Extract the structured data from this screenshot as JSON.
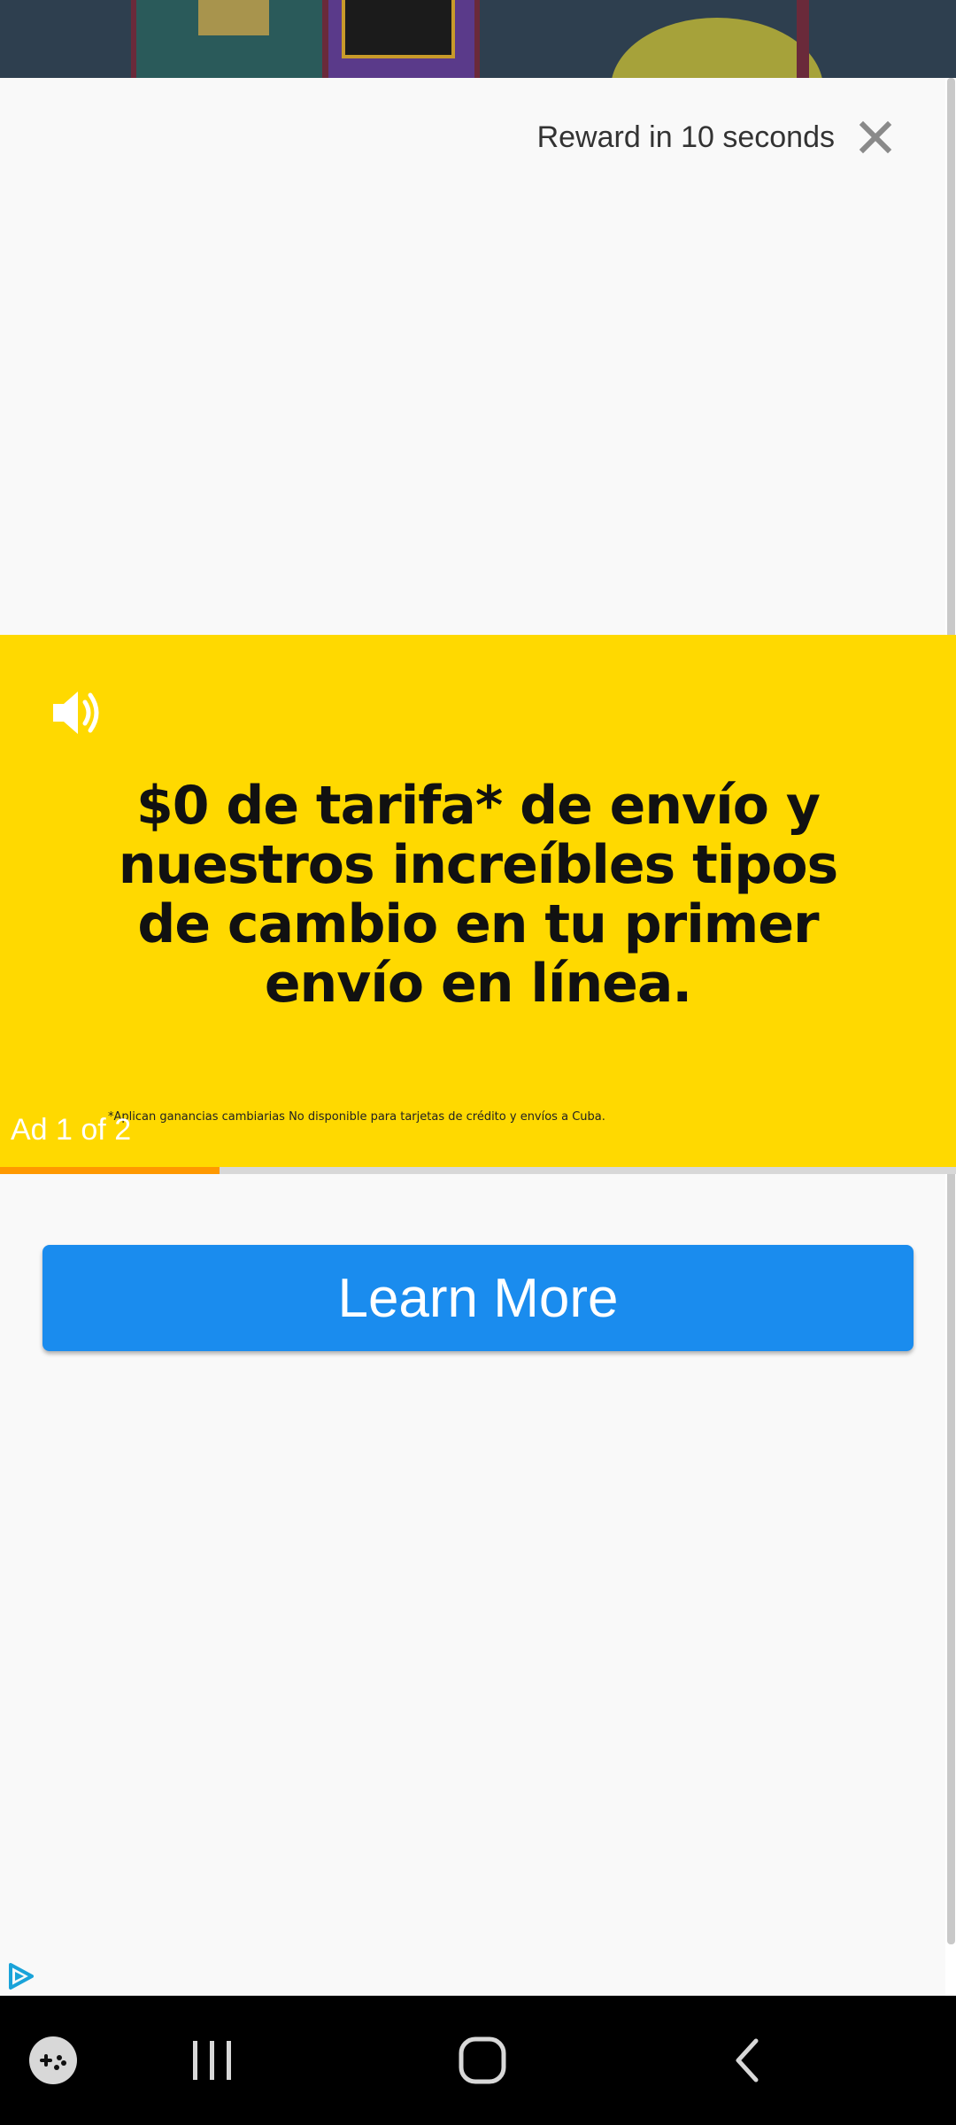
{
  "ad": {
    "reward_text": "Reward in 10 seconds",
    "counter": "Ad 1 of 2",
    "cta_label": "Learn More",
    "progress": 0.23
  },
  "creative": {
    "headline_bold": "$0 de tarifa* de envío",
    "headline_rest_line1": "y",
    "headline_line2": "nuestros increíbles tipos",
    "headline_line3": "de cambio en tu primer",
    "headline_line4": "envío en línea.",
    "fineprint": "*Aplican ganancias cambiarias No disponible para tarjetas de crédito y envíos a Cuba."
  },
  "colors": {
    "creative_bg": "#ffd900",
    "cta_bg": "#1a8cee",
    "progress": "#ff9900"
  },
  "icons": {
    "close": "close-icon",
    "sound": "speaker-icon",
    "adchoices": "adchoices-icon",
    "game": "game-controller-icon",
    "recent": "recent-apps-icon",
    "home": "home-icon",
    "back": "back-icon"
  }
}
